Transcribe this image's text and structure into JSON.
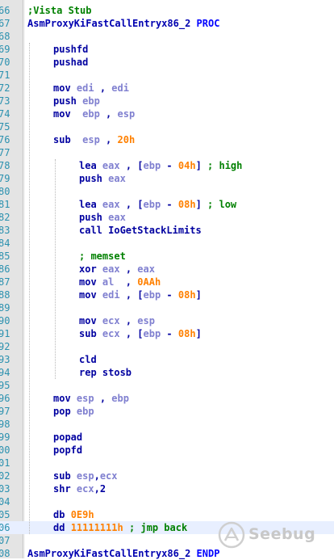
{
  "editor": {
    "lines": [
      {
        "num": "66",
        "indent": 0,
        "tokens": [
          {
            "t": ";Vista Stub",
            "c": "cmt"
          }
        ]
      },
      {
        "num": "67",
        "indent": 0,
        "tokens": [
          {
            "t": "AsmProxyKiFastCallEntryx86_2 ",
            "c": "label"
          },
          {
            "t": "PROC",
            "c": "proc"
          }
        ]
      },
      {
        "num": "68",
        "indent": 0,
        "tokens": []
      },
      {
        "num": "69",
        "indent": 1,
        "tokens": [
          {
            "t": "pushfd",
            "c": "mn"
          }
        ]
      },
      {
        "num": "70",
        "indent": 1,
        "tokens": [
          {
            "t": "pushad",
            "c": "mn"
          }
        ]
      },
      {
        "num": "71",
        "indent": 0,
        "tokens": []
      },
      {
        "num": "72",
        "indent": 1,
        "tokens": [
          {
            "t": "mov ",
            "c": "mn"
          },
          {
            "t": "edi",
            "c": "reg"
          },
          {
            "t": " , ",
            "c": "sym"
          },
          {
            "t": "edi",
            "c": "reg"
          }
        ]
      },
      {
        "num": "73",
        "indent": 1,
        "tokens": [
          {
            "t": "push ",
            "c": "mn"
          },
          {
            "t": "ebp",
            "c": "reg"
          }
        ]
      },
      {
        "num": "74",
        "indent": 1,
        "tokens": [
          {
            "t": "mov  ",
            "c": "mn"
          },
          {
            "t": "ebp",
            "c": "reg"
          },
          {
            "t": " , ",
            "c": "sym"
          },
          {
            "t": "esp",
            "c": "reg"
          }
        ]
      },
      {
        "num": "75",
        "indent": 0,
        "tokens": []
      },
      {
        "num": "76",
        "indent": 1,
        "tokens": [
          {
            "t": "sub  ",
            "c": "mn"
          },
          {
            "t": "esp",
            "c": "reg"
          },
          {
            "t": " , ",
            "c": "sym"
          },
          {
            "t": "20h",
            "c": "num"
          }
        ]
      },
      {
        "num": "77",
        "indent": 0,
        "tokens": []
      },
      {
        "num": "78",
        "indent": 2,
        "tokens": [
          {
            "t": "lea ",
            "c": "mn"
          },
          {
            "t": "eax",
            "c": "reg"
          },
          {
            "t": " , [",
            "c": "sym"
          },
          {
            "t": "ebp",
            "c": "reg"
          },
          {
            "t": " - ",
            "c": "sym"
          },
          {
            "t": "04h",
            "c": "num"
          },
          {
            "t": "] ",
            "c": "sym"
          },
          {
            "t": "; high",
            "c": "cmt"
          }
        ]
      },
      {
        "num": "79",
        "indent": 2,
        "tokens": [
          {
            "t": "push ",
            "c": "mn"
          },
          {
            "t": "eax",
            "c": "reg"
          }
        ]
      },
      {
        "num": "80",
        "indent": 0,
        "tokens": []
      },
      {
        "num": "81",
        "indent": 2,
        "tokens": [
          {
            "t": "lea ",
            "c": "mn"
          },
          {
            "t": "eax",
            "c": "reg"
          },
          {
            "t": " , [",
            "c": "sym"
          },
          {
            "t": "ebp",
            "c": "reg"
          },
          {
            "t": " - ",
            "c": "sym"
          },
          {
            "t": "08h",
            "c": "num"
          },
          {
            "t": "] ",
            "c": "sym"
          },
          {
            "t": "; low",
            "c": "cmt"
          }
        ]
      },
      {
        "num": "82",
        "indent": 2,
        "tokens": [
          {
            "t": "push ",
            "c": "mn"
          },
          {
            "t": "eax",
            "c": "reg"
          }
        ]
      },
      {
        "num": "83",
        "indent": 2,
        "tokens": [
          {
            "t": "call ",
            "c": "mn"
          },
          {
            "t": "IoGetStackLimits",
            "c": "plain"
          }
        ]
      },
      {
        "num": "84",
        "indent": 0,
        "tokens": []
      },
      {
        "num": "85",
        "indent": 2,
        "tokens": [
          {
            "t": "; memset",
            "c": "cmt"
          }
        ]
      },
      {
        "num": "86",
        "indent": 2,
        "tokens": [
          {
            "t": "xor ",
            "c": "mn"
          },
          {
            "t": "eax",
            "c": "reg"
          },
          {
            "t": " , ",
            "c": "sym"
          },
          {
            "t": "eax",
            "c": "reg"
          }
        ]
      },
      {
        "num": "87",
        "indent": 2,
        "tokens": [
          {
            "t": "mov ",
            "c": "mn"
          },
          {
            "t": "al",
            "c": "reg"
          },
          {
            "t": "  , ",
            "c": "sym"
          },
          {
            "t": "0AAh",
            "c": "num"
          }
        ]
      },
      {
        "num": "88",
        "indent": 2,
        "tokens": [
          {
            "t": "mov ",
            "c": "mn"
          },
          {
            "t": "edi",
            "c": "reg"
          },
          {
            "t": " , [",
            "c": "sym"
          },
          {
            "t": "ebp",
            "c": "reg"
          },
          {
            "t": " - ",
            "c": "sym"
          },
          {
            "t": "08h",
            "c": "num"
          },
          {
            "t": "]",
            "c": "sym"
          }
        ]
      },
      {
        "num": "89",
        "indent": 0,
        "tokens": []
      },
      {
        "num": "90",
        "indent": 2,
        "tokens": [
          {
            "t": "mov ",
            "c": "mn"
          },
          {
            "t": "ecx",
            "c": "reg"
          },
          {
            "t": " , ",
            "c": "sym"
          },
          {
            "t": "esp",
            "c": "reg"
          }
        ]
      },
      {
        "num": "91",
        "indent": 2,
        "tokens": [
          {
            "t": "sub ",
            "c": "mn"
          },
          {
            "t": "ecx",
            "c": "reg"
          },
          {
            "t": " , [",
            "c": "sym"
          },
          {
            "t": "ebp",
            "c": "reg"
          },
          {
            "t": " - ",
            "c": "sym"
          },
          {
            "t": "08h",
            "c": "num"
          },
          {
            "t": "]",
            "c": "sym"
          }
        ]
      },
      {
        "num": "92",
        "indent": 0,
        "tokens": []
      },
      {
        "num": "93",
        "indent": 2,
        "tokens": [
          {
            "t": "cld",
            "c": "mn"
          }
        ]
      },
      {
        "num": "94",
        "indent": 2,
        "tokens": [
          {
            "t": "rep stosb",
            "c": "mn"
          }
        ]
      },
      {
        "num": "95",
        "indent": 0,
        "tokens": []
      },
      {
        "num": "96",
        "indent": 1,
        "tokens": [
          {
            "t": "mov ",
            "c": "mn"
          },
          {
            "t": "esp",
            "c": "reg"
          },
          {
            "t": " , ",
            "c": "sym"
          },
          {
            "t": "ebp",
            "c": "reg"
          }
        ]
      },
      {
        "num": "97",
        "indent": 1,
        "tokens": [
          {
            "t": "pop ",
            "c": "mn"
          },
          {
            "t": "ebp",
            "c": "reg"
          }
        ]
      },
      {
        "num": "98",
        "indent": 0,
        "tokens": []
      },
      {
        "num": "99",
        "indent": 1,
        "tokens": [
          {
            "t": "popad",
            "c": "mn"
          }
        ]
      },
      {
        "num": "00",
        "indent": 1,
        "tokens": [
          {
            "t": "popfd",
            "c": "mn"
          }
        ]
      },
      {
        "num": "01",
        "indent": 0,
        "tokens": []
      },
      {
        "num": "02",
        "indent": 1,
        "tokens": [
          {
            "t": "sub ",
            "c": "mn"
          },
          {
            "t": "esp",
            "c": "reg"
          },
          {
            "t": ",",
            "c": "sym"
          },
          {
            "t": "ecx",
            "c": "reg"
          }
        ]
      },
      {
        "num": "03",
        "indent": 1,
        "tokens": [
          {
            "t": "shr ",
            "c": "mn"
          },
          {
            "t": "ecx",
            "c": "reg"
          },
          {
            "t": ",",
            "c": "sym"
          },
          {
            "t": "2",
            "c": "plain"
          }
        ]
      },
      {
        "num": "04",
        "indent": 0,
        "tokens": []
      },
      {
        "num": "05",
        "indent": 1,
        "tokens": [
          {
            "t": "db ",
            "c": "mn"
          },
          {
            "t": "0E9h",
            "c": "num"
          }
        ]
      },
      {
        "num": "06",
        "indent": 1,
        "highlight": true,
        "tokens": [
          {
            "t": "dd ",
            "c": "mn"
          },
          {
            "t": "11111111h",
            "c": "num"
          },
          {
            "t": " ; jmp back",
            "c": "cmt"
          }
        ]
      },
      {
        "num": "07",
        "indent": 0,
        "tokens": []
      },
      {
        "num": "08",
        "indent": 0,
        "tokens": [
          {
            "t": "AsmProxyKiFastCallEntryx86_2 ",
            "c": "label"
          },
          {
            "t": "ENDP",
            "c": "proc"
          }
        ]
      }
    ]
  },
  "watermark": {
    "text": "Seebug",
    "icon": "seebug-logo-icon"
  }
}
